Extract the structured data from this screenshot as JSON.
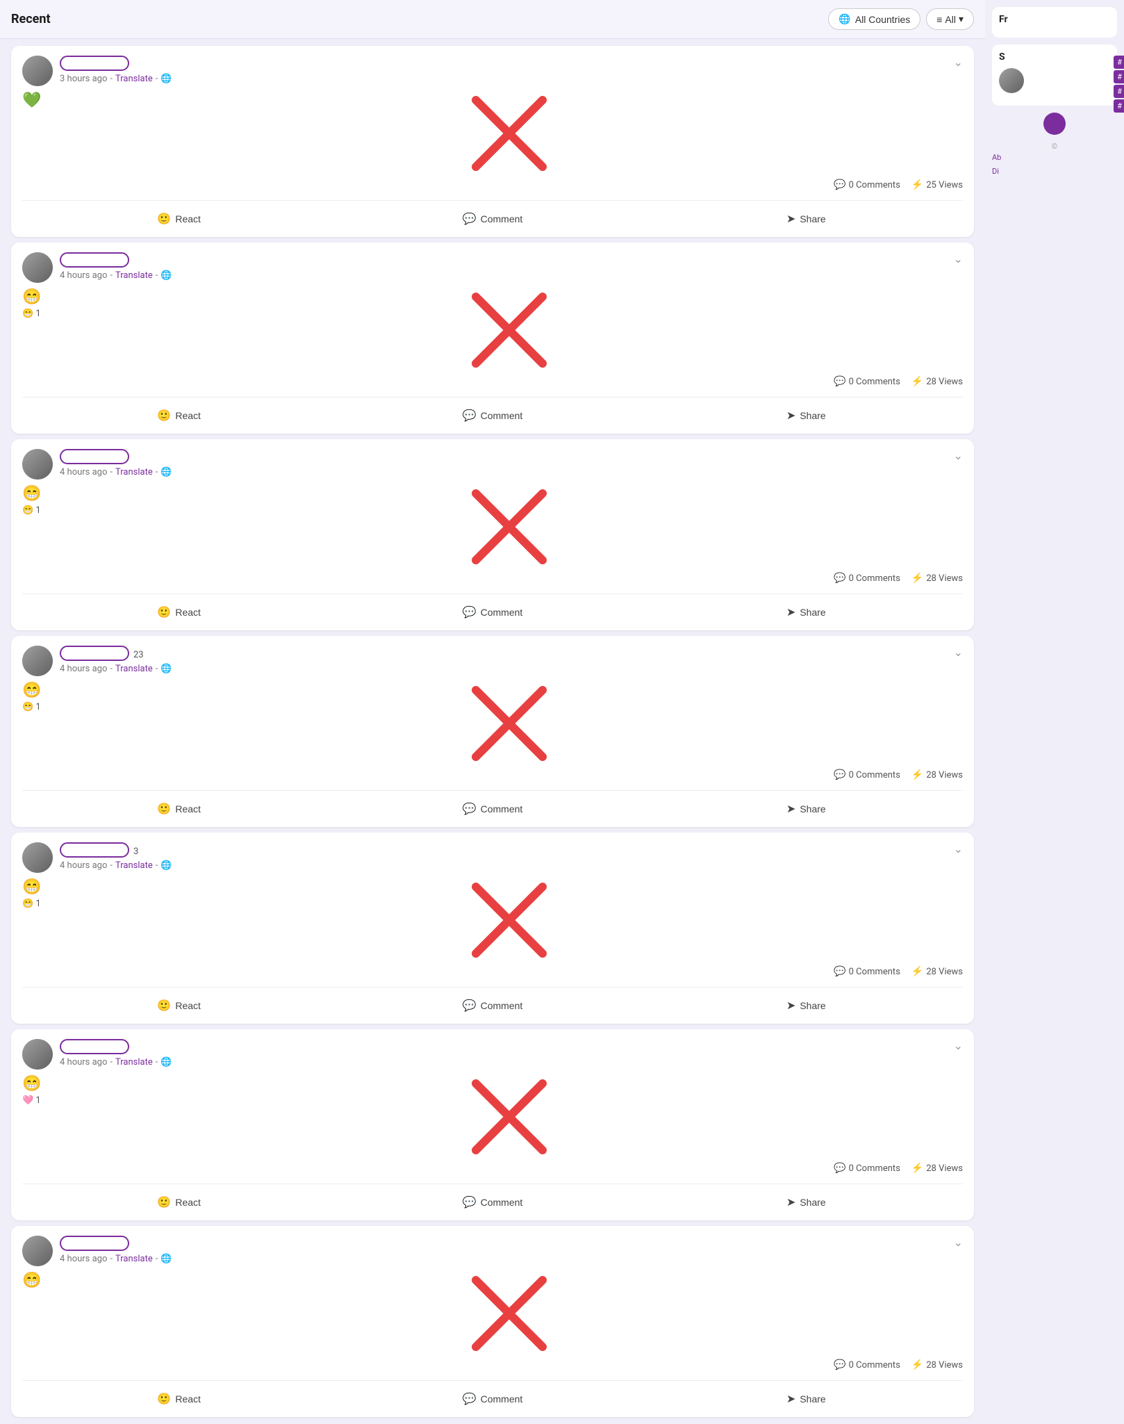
{
  "header": {
    "title": "Recent",
    "all_countries_label": "All Countries",
    "all_label": "All"
  },
  "posts": [
    {
      "id": 1,
      "username_placeholder": "",
      "time_ago": "3 hours ago",
      "translate_label": "Translate",
      "reaction_emoji": "💚",
      "reaction_count": "",
      "comments_count": "0 Comments",
      "views_count": "25 Views",
      "react_label": "React",
      "comment_label": "Comment",
      "share_label": "Share"
    },
    {
      "id": 2,
      "username_placeholder": "",
      "time_ago": "4 hours ago",
      "translate_label": "Translate",
      "reaction_emoji": "😁",
      "reaction_count": "😁 1",
      "comments_count": "0 Comments",
      "views_count": "28 Views",
      "react_label": "React",
      "comment_label": "Comment",
      "share_label": "Share"
    },
    {
      "id": 3,
      "username_placeholder": "",
      "time_ago": "4 hours ago",
      "translate_label": "Translate",
      "reaction_emoji": "😁",
      "reaction_count": "😁 1",
      "comments_count": "0 Comments",
      "views_count": "28 Views",
      "react_label": "React",
      "comment_label": "Comment",
      "share_label": "Share"
    },
    {
      "id": 4,
      "username_placeholder": "23",
      "time_ago": "4 hours ago",
      "translate_label": "Translate",
      "reaction_emoji": "😁",
      "reaction_count": "😁 1",
      "comments_count": "0 Comments",
      "views_count": "28 Views",
      "react_label": "React",
      "comment_label": "Comment",
      "share_label": "Share"
    },
    {
      "id": 5,
      "username_placeholder": "3",
      "time_ago": "4 hours ago",
      "translate_label": "Translate",
      "reaction_emoji": "😁",
      "reaction_count": "😁 1",
      "comments_count": "0 Comments",
      "views_count": "28 Views",
      "react_label": "React",
      "comment_label": "Comment",
      "share_label": "Share"
    },
    {
      "id": 6,
      "username_placeholder": "",
      "time_ago": "4 hours ago",
      "translate_label": "Translate",
      "reaction_emoji": "😁",
      "reaction_count": "🩷 1",
      "comments_count": "0 Comments",
      "views_count": "28 Views",
      "react_label": "React",
      "comment_label": "Comment",
      "share_label": "Share"
    },
    {
      "id": 7,
      "username_placeholder": "",
      "time_ago": "4 hours ago",
      "translate_label": "Translate",
      "reaction_emoji": "😁",
      "reaction_count": "",
      "comments_count": "0 Comments",
      "views_count": "28 Views",
      "react_label": "React",
      "comment_label": "Comment",
      "share_label": "Share"
    }
  ],
  "sidebar": {
    "friends_title": "Fr",
    "suggestions_title": "S",
    "copyright": "©",
    "links": [
      "Ab",
      "Di"
    ],
    "hashtags": [
      "#",
      "#",
      "#",
      "#"
    ]
  }
}
